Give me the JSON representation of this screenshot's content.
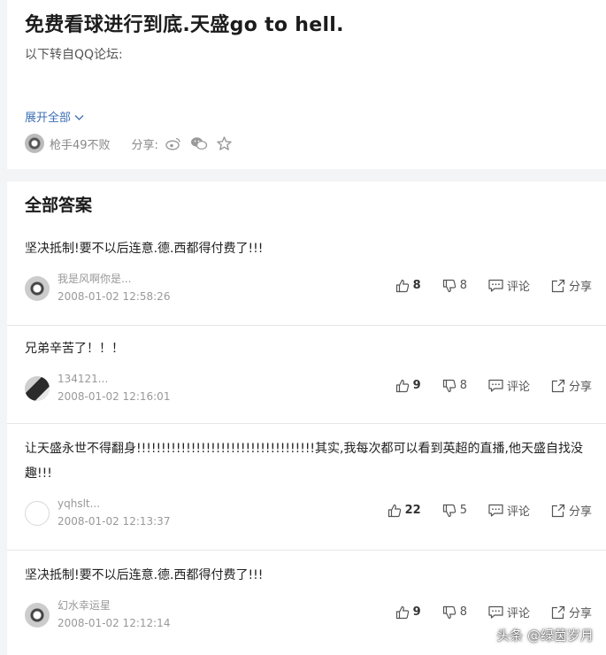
{
  "question": {
    "title": "免费看球进行到底.天盛go to hell.",
    "body": "以下转自QQ论坛:",
    "expand_label": "展开全部",
    "author": "枪手49不败",
    "share_label": "分享:"
  },
  "answers_section": {
    "header": "全部答案",
    "comment_label": "评论",
    "share_label": "分享"
  },
  "answers": [
    {
      "text": "坚决抵制!要不以后连意.德.西都得付费了!!!",
      "author": "我是风啊你是...",
      "date": "2008-01-02 12:58:26",
      "likes": "8",
      "dislikes": "8"
    },
    {
      "text": "兄弟辛苦了！！！",
      "author": "134121...",
      "date": "2008-01-02 12:16:01",
      "likes": "9",
      "dislikes": "8"
    },
    {
      "text": "让天盛永世不得翻身!!!!!!!!!!!!!!!!!!!!!!!!!!!!!!!!!!!!其实,我每次都可以看到英超的直播,他天盛自找没趣!!!",
      "author": "yqhslt...",
      "date": "2008-01-02 12:13:37",
      "likes": "22",
      "dislikes": "5"
    },
    {
      "text": "坚决抵制!要不以后连意.德.西都得付费了!!!",
      "author": "幻水幸运星",
      "date": "2008-01-02 12:12:14",
      "likes": "9",
      "dislikes": "8"
    }
  ],
  "watermark": "头条 @绿茵岁月",
  "icons": [
    "user-avatar-icon",
    "weibo-icon",
    "wechat-icon",
    "star-icon",
    "chevron-down-icon",
    "thumbs-up-icon",
    "thumbs-down-icon",
    "comment-icon",
    "share-icon"
  ],
  "colors": {
    "link": "#3d6fb4",
    "muted": "#999999",
    "text": "#222222"
  }
}
